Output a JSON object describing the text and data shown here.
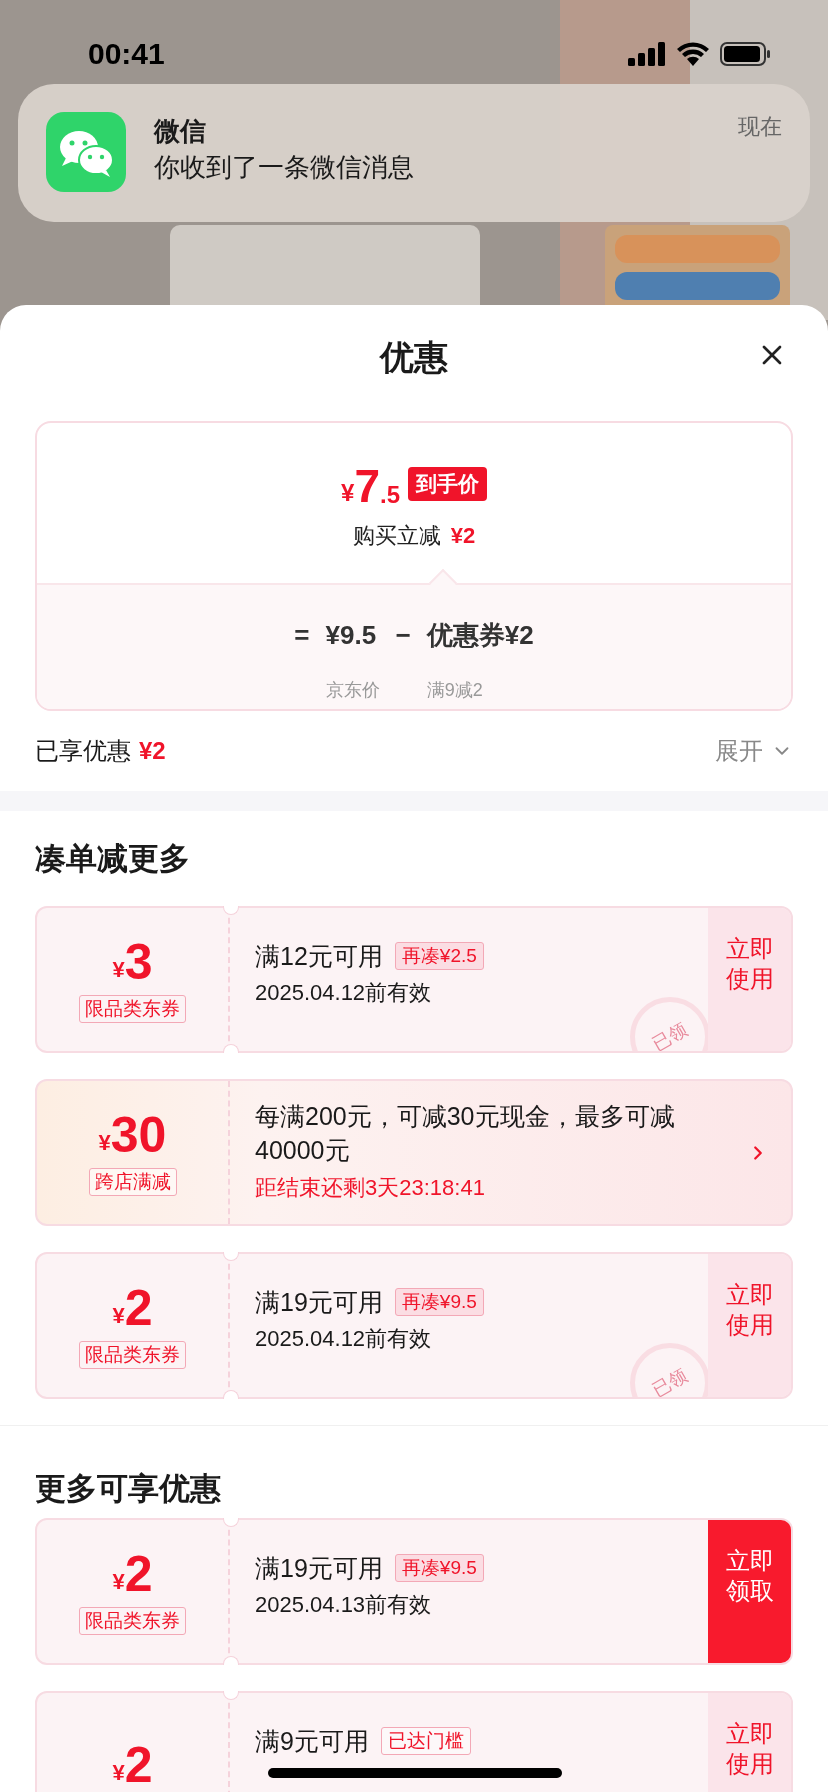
{
  "status_bar": {
    "time": "00:41"
  },
  "notification": {
    "app": "微信",
    "message": "你收到了一条微信消息",
    "time": "现在"
  },
  "sheet": {
    "title": "优惠"
  },
  "price_card": {
    "currency": "¥",
    "integer": "7",
    "decimal": ".5",
    "badge": "到手价",
    "saving_label": "购买立减",
    "saving_amount": "¥2",
    "equals": "=",
    "base_price": "¥9.5",
    "minus": "−",
    "coupon_label": "优惠券¥2",
    "base_caption": "京东价",
    "coupon_caption": "满9减2"
  },
  "summary": {
    "label": "已享优惠",
    "amount": "¥2",
    "toggle": "展开"
  },
  "sections": [
    {
      "title": "凑单减更多",
      "coupons": [
        {
          "kind": "coupon",
          "currency": "¥",
          "amount": "3",
          "tag": "限品类东券",
          "condition": "满12元可用",
          "hint": "再凑¥2.5",
          "hint_filled": true,
          "validity": "2025.04.12前有效",
          "action": "立即使用",
          "claimed": true,
          "stamp": "已领"
        },
        {
          "kind": "promo",
          "currency": "¥",
          "amount": "30",
          "tag": "跨店满减",
          "description": "每满200元，可减30元现金，最多可减40000元",
          "countdown": "距结束还剩3天23:18:41"
        },
        {
          "kind": "coupon",
          "currency": "¥",
          "amount": "2",
          "tag": "限品类东券",
          "condition": "满19元可用",
          "hint": "再凑¥9.5",
          "hint_filled": true,
          "validity": "2025.04.12前有效",
          "action": "立即使用",
          "claimed": true,
          "stamp": "已领"
        }
      ]
    },
    {
      "title": "更多可享优惠",
      "coupons": [
        {
          "kind": "coupon",
          "currency": "¥",
          "amount": "2",
          "tag": "限品类东券",
          "condition": "满19元可用",
          "hint": "再凑¥9.5",
          "hint_filled": true,
          "validity": "2025.04.13前有效",
          "action": "立即领取",
          "claimed": false
        },
        {
          "kind": "coupon",
          "currency": "¥",
          "amount": "2",
          "condition": "满9元可用",
          "hint": "已达门槛",
          "hint_filled": false,
          "action": "立即使用",
          "claimed": true
        }
      ]
    }
  ]
}
